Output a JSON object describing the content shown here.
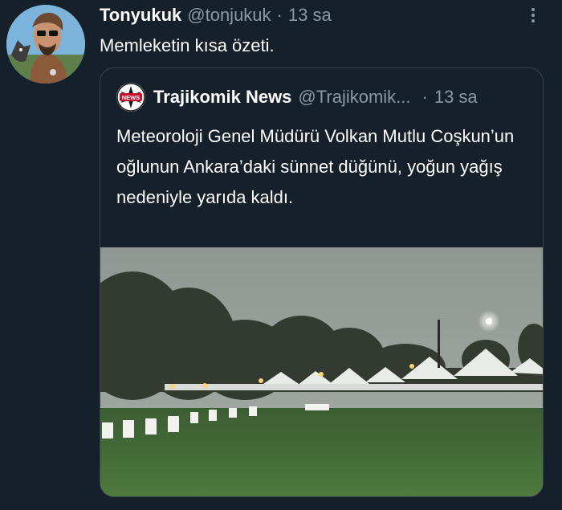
{
  "tweet": {
    "author_name": "Tonyukuk",
    "handle": "@tonjukuk",
    "separator": "·",
    "time": "13 sa",
    "text": "Memleketin kısa özeti."
  },
  "quoted": {
    "logo_text": "NEWS",
    "author_name": "Trajikomik News",
    "handle": "@Trajikomik...",
    "separator": "·",
    "time": "13 sa",
    "text": "Meteoroloji Genel Müdürü Volkan Mutlu Coşkun’un oğlunun Ankara’daki sünnet düğünü, yoğun yağış nedeniyle yarıda kaldı."
  },
  "colors": {
    "background": "#15202b",
    "border": "#38444d",
    "muted_text": "#8b98a5"
  },
  "icons": [
    "more-options-icon"
  ]
}
